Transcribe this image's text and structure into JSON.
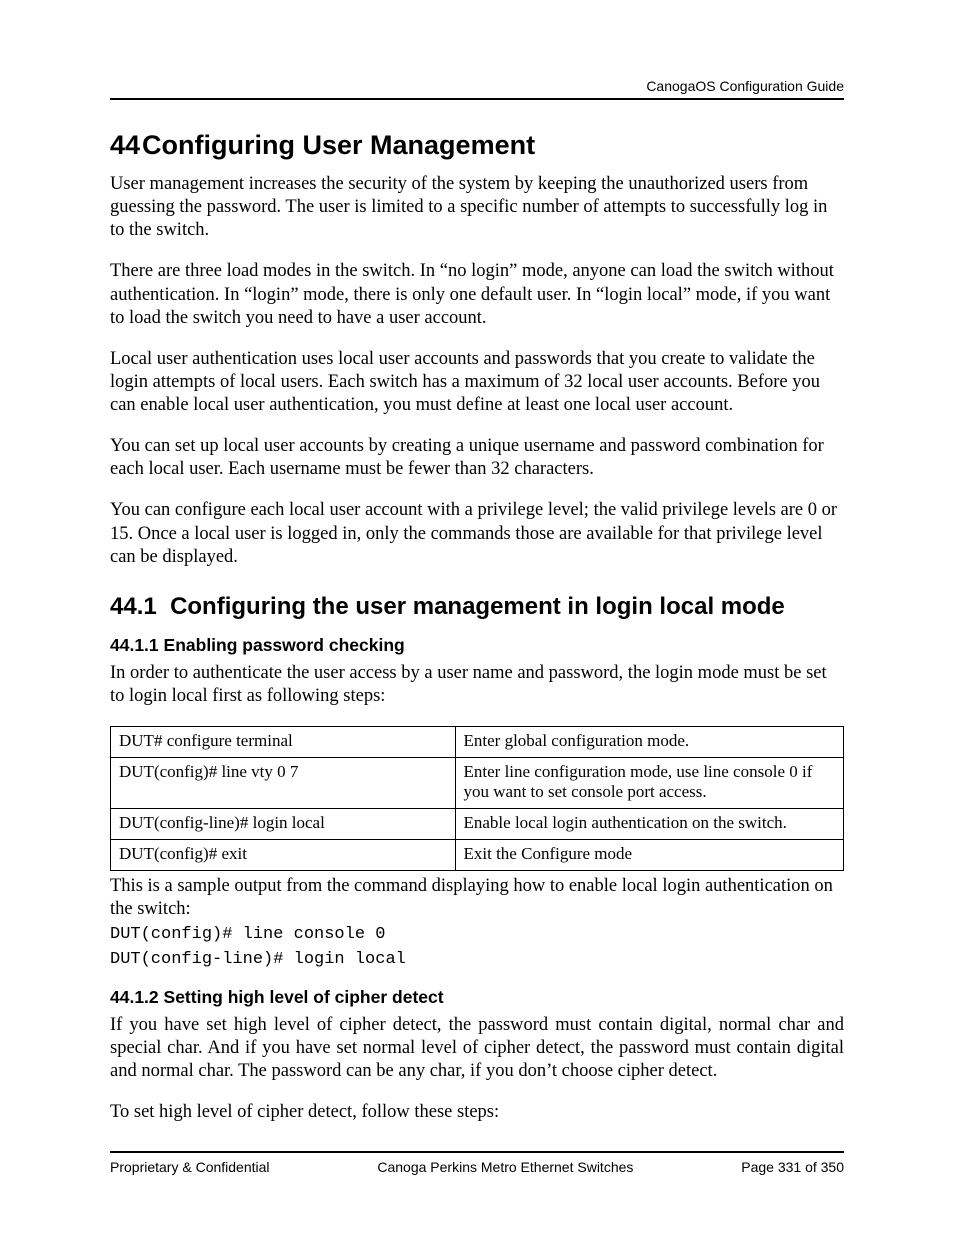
{
  "header": {
    "doc_title": "CanogaOS Configuration Guide"
  },
  "chapter": {
    "number": "44",
    "title": "Configuring User Management",
    "paragraphs": [
      "User management increases the security of the system by keeping the unauthorized users from guessing the password. The user is limited to a specific number of attempts to successfully log in to the switch.",
      "There are three load modes in the switch. In “no login” mode, anyone can load the switch without authentication. In “login” mode, there is only one default user. In “login local” mode, if you want to load the switch you need to have a user account.",
      "Local user authentication uses local user accounts and passwords that you create to validate the login attempts of local users. Each switch has a maximum of 32 local user accounts. Before you can enable local user authentication, you must define at least one local user account.",
      "You can set up local user accounts by creating a unique username and password combination for each local user. Each username must be fewer than 32 characters.",
      "You can configure each local user account with a privilege level; the valid privilege levels are 0 or 15. Once a local user is logged in, only the commands those are available for that privilege level can be displayed."
    ]
  },
  "section": {
    "number": "44.1",
    "title": "Configuring the user management in login local mode"
  },
  "sub1": {
    "number": "44.1.1",
    "title": "Enabling password checking",
    "intro": "In order to authenticate the user access by a user name and password, the login mode must be set to login local first as following steps:",
    "table": [
      {
        "cmd": "DUT# configure terminal",
        "desc": "Enter global configuration mode."
      },
      {
        "cmd": "DUT(config)# line vty 0 7",
        "desc": "Enter line configuration mode, use line console 0 if you want to set console port access."
      },
      {
        "cmd": "DUT(config-line)# login local",
        "desc": "Enable local login authentication on the switch."
      },
      {
        "cmd": "DUT(config)# exit",
        "desc": "Exit the Configure mode"
      }
    ],
    "after_table": "This is a sample output from the command displaying how to enable local login authentication on the switch:",
    "code": "DUT(config)# line console 0\nDUT(config-line)# login local"
  },
  "sub2": {
    "number": "44.1.2",
    "title": "Setting high level of cipher detect",
    "p1": "If you have set high level of cipher detect, the password must contain digital, normal char and special char. And if you have set normal level of cipher detect, the password must contain digital and normal char. The password can be any char, if you don’t choose cipher detect.",
    "p2": "To set high level of cipher detect, follow these steps:"
  },
  "footer": {
    "left": "Proprietary & Confidential",
    "center": "Canoga Perkins Metro Ethernet Switches",
    "right": "Page 331 of 350"
  }
}
